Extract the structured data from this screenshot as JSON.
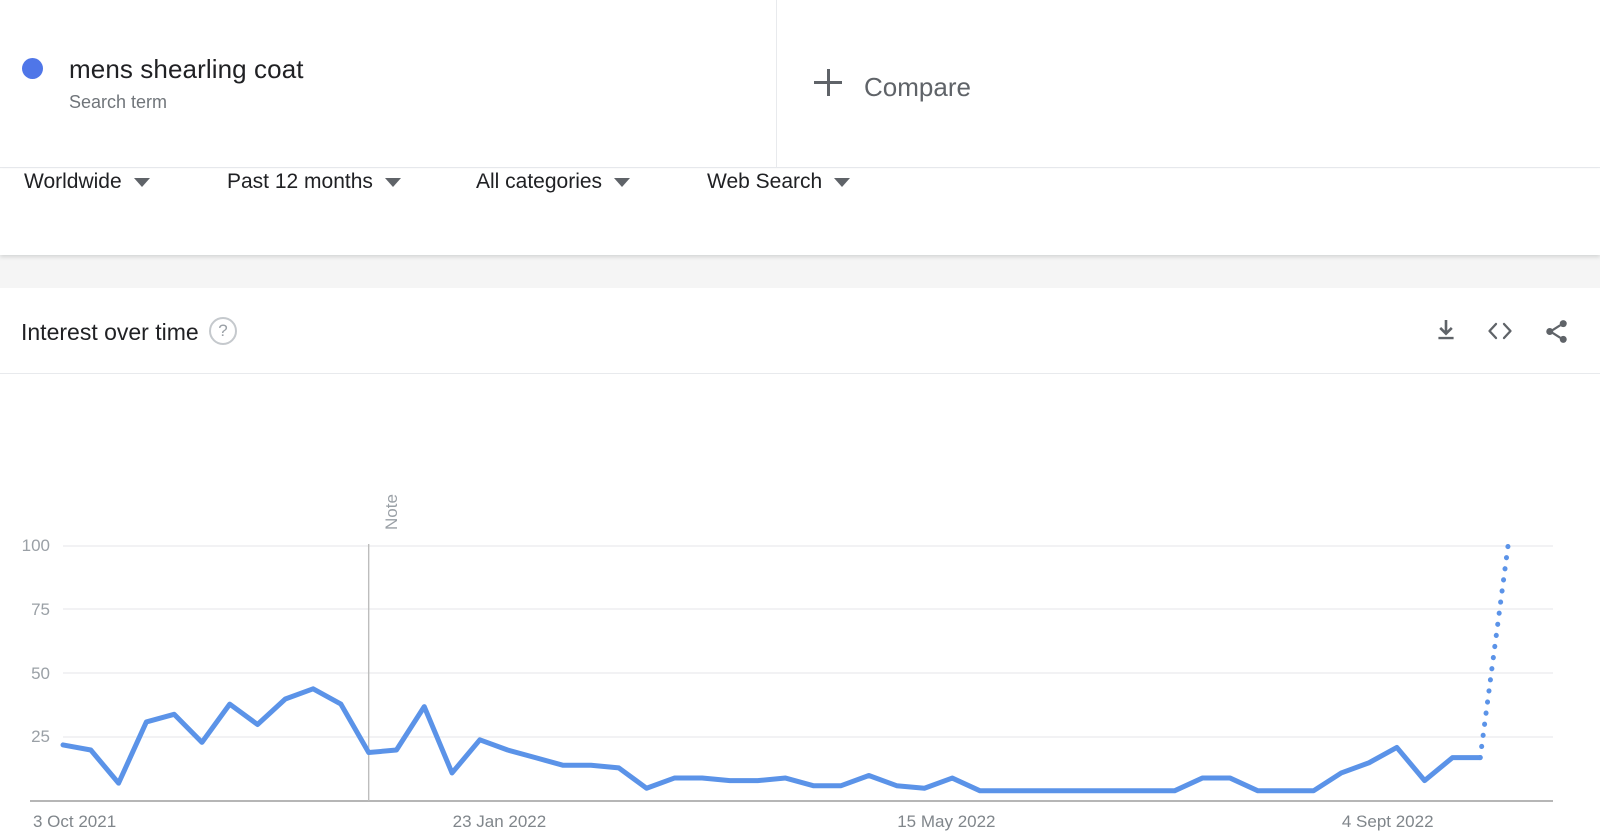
{
  "term": {
    "title": "mens shearling coat",
    "subtitle": "Search term",
    "dot_color": "#4f76e8"
  },
  "compare": {
    "label": "Compare",
    "icon": "plus-icon"
  },
  "filters": [
    {
      "label": "Worldwide",
      "icon": "chevron-down-icon"
    },
    {
      "label": "Past 12 months",
      "icon": "chevron-down-icon"
    },
    {
      "label": "All categories",
      "icon": "chevron-down-icon"
    },
    {
      "label": "Web Search",
      "icon": "chevron-down-icon"
    }
  ],
  "card": {
    "title": "Interest over time",
    "help_icon": "help-icon",
    "help_glyph": "?",
    "actions": [
      {
        "name": "download-icon",
        "tooltip": "Download"
      },
      {
        "name": "embed-code-icon",
        "tooltip": "Embed"
      },
      {
        "name": "share-icon",
        "tooltip": "Share"
      }
    ]
  },
  "chart_data": {
    "type": "line",
    "title": "Interest over time",
    "xlabel": "",
    "ylabel": "",
    "ylim": [
      0,
      100
    ],
    "y_ticks": [
      100,
      75,
      50,
      25
    ],
    "grid": true,
    "legend": [
      "mens shearling coat"
    ],
    "legend_position": "top",
    "line_color": "#5b93e8",
    "x_tick_labels": [
      "3 Oct 2021",
      "23 Jan 2022",
      "15 May 2022",
      "4 Sept 2022"
    ],
    "x_tick_indices": [
      0,
      16,
      32,
      48
    ],
    "annotations": [
      {
        "label": "Note",
        "x_index": 11,
        "orientation": "vertical"
      }
    ],
    "partial_data_from_index": 51,
    "partial_style": "dotted",
    "x": [
      "3 Oct 2021",
      "10 Oct 2021",
      "17 Oct 2021",
      "24 Oct 2021",
      "31 Oct 2021",
      "7 Nov 2021",
      "14 Nov 2021",
      "21 Nov 2021",
      "28 Nov 2021",
      "5 Dec 2021",
      "12 Dec 2021",
      "19 Dec 2021",
      "26 Dec 2021",
      "2 Jan 2022",
      "9 Jan 2022",
      "16 Jan 2022",
      "23 Jan 2022",
      "30 Jan 2022",
      "6 Feb 2022",
      "13 Feb 2022",
      "20 Feb 2022",
      "27 Feb 2022",
      "6 Mar 2022",
      "13 Mar 2022",
      "20 Mar 2022",
      "27 Mar 2022",
      "3 Apr 2022",
      "10 Apr 2022",
      "17 Apr 2022",
      "24 Apr 2022",
      "1 May 2022",
      "8 May 2022",
      "15 May 2022",
      "22 May 2022",
      "29 May 2022",
      "5 Jun 2022",
      "12 Jun 2022",
      "19 Jun 2022",
      "26 Jun 2022",
      "3 Jul 2022",
      "10 Jul 2022",
      "17 Jul 2022",
      "24 Jul 2022",
      "31 Jul 2022",
      "7 Aug 2022",
      "14 Aug 2022",
      "21 Aug 2022",
      "28 Aug 2022",
      "4 Sept 2022",
      "11 Sept 2022",
      "18 Sept 2022",
      "25 Sept 2022",
      "2 Oct 2022"
    ],
    "values": [
      22,
      20,
      7,
      31,
      34,
      23,
      38,
      30,
      40,
      44,
      38,
      19,
      20,
      37,
      11,
      24,
      20,
      17,
      14,
      14,
      13,
      5,
      9,
      9,
      8,
      8,
      9,
      6,
      6,
      10,
      6,
      5,
      9,
      4,
      4,
      4,
      4,
      4,
      4,
      4,
      4,
      9,
      9,
      4,
      4,
      4,
      11,
      15,
      21,
      8,
      17,
      17,
      100
    ]
  }
}
